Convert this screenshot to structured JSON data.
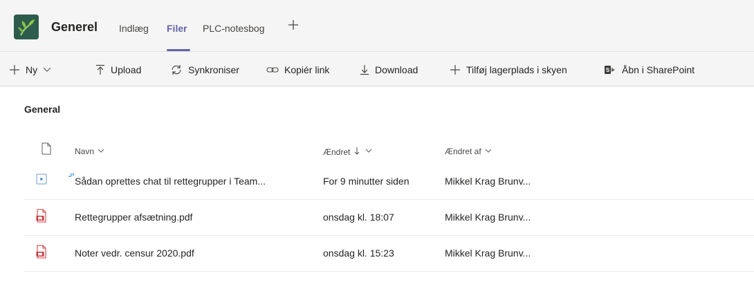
{
  "header": {
    "channel_name": "Generel",
    "tabs": [
      {
        "label": "Indlæg",
        "active": false
      },
      {
        "label": "Filer",
        "active": true
      },
      {
        "label": "PLC-notesbog",
        "active": false
      }
    ],
    "add_tab_icon": "plus-icon"
  },
  "toolbar": {
    "new_label": "Ny",
    "upload_label": "Upload",
    "sync_label": "Synkroniser",
    "copy_link_label": "Kopiér link",
    "download_label": "Download",
    "add_cloud_label": "Tilføj lagerplads i skyen",
    "open_sharepoint_label": "Åbn i SharePoint"
  },
  "folder": {
    "title": "General"
  },
  "table": {
    "columns": {
      "name": "Navn",
      "modified": "Ændret",
      "modified_by": "Ændret af"
    },
    "rows": [
      {
        "name": "Sådan oprettes chat til rettegrupper i Team...",
        "modified": "For 9 minutter siden",
        "modified_by": "Mikkel Krag Brunv...",
        "type": "video"
      },
      {
        "name": "Rettegrupper afsætning.pdf",
        "modified": "onsdag kl. 18:07",
        "modified_by": "Mikkel Krag Brunv...",
        "type": "pdf"
      },
      {
        "name": "Noter vedr. censur 2020.pdf",
        "modified": "onsdag kl. 15:23",
        "modified_by": "Mikkel Krag Brunv...",
        "type": "pdf"
      }
    ]
  },
  "colors": {
    "accent": "#6264a7",
    "pdf_red": "#d13438",
    "logo_bg": "#2d5c4d",
    "leaf_green": "#8cc63f"
  }
}
